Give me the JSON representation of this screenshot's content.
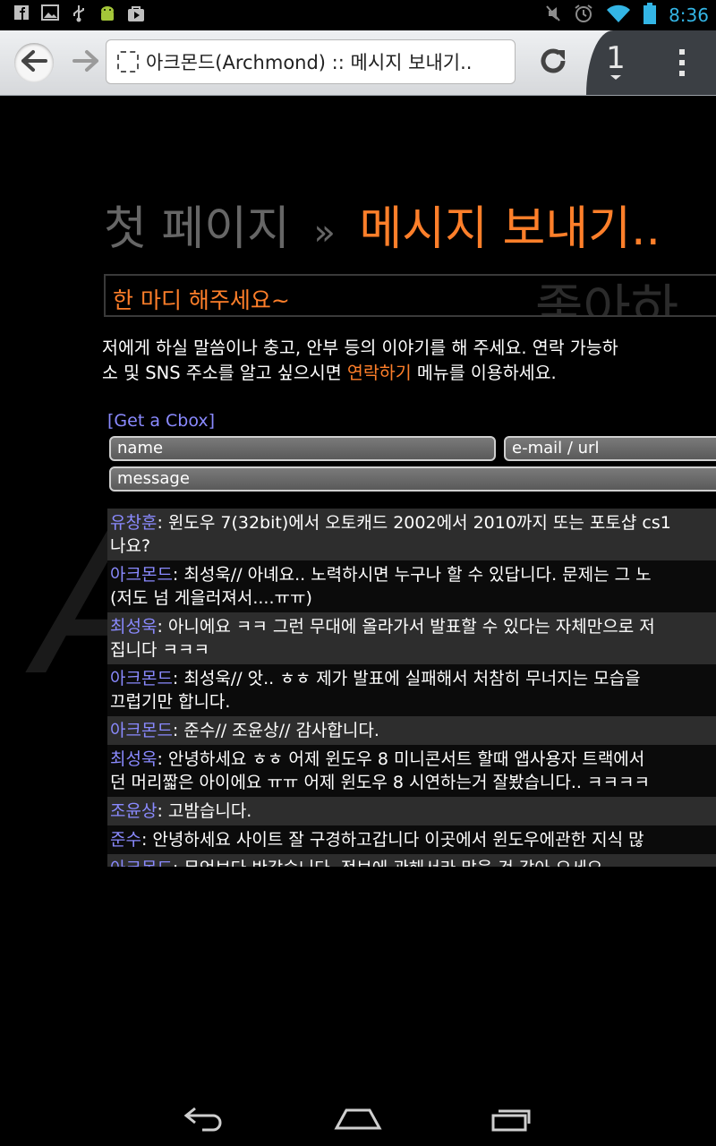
{
  "status_bar": {
    "left_icons": [
      "facebook-icon",
      "gallery-icon",
      "usb-icon",
      "android-icon",
      "play-store-icon"
    ],
    "right_icons": [
      "mute-icon",
      "alarm-icon",
      "wifi-icon",
      "battery-icon"
    ],
    "clock": "8:36"
  },
  "browser": {
    "tab_title": "아크몬드(Archmond) :: 메시지 보내기..",
    "tab_count": "1"
  },
  "page": {
    "heading_crumb": "첫 페이지",
    "heading_sep": "»",
    "heading_current": "메시지 보내기..",
    "subtitle": "한 마디 해주세요~",
    "subtitle_bg": "좋아하",
    "watermark": "A",
    "intro_line1": "저에게 하실 말씀이나 충고, 안부 등의 이야기를 해 주세요. 연락 가능하",
    "intro_line2_before": "소 및 SNS 주소를 알고 싶으시면 ",
    "intro_link": "연락하기",
    "intro_line2_after": " 메뉴를 이용하세요."
  },
  "cbox": {
    "get_cbox_label": "[Get a Cbox]",
    "name_placeholder": "name",
    "email_placeholder": "e-mail / url",
    "message_placeholder": "message",
    "messages": [
      {
        "author": "유창훈",
        "text": ": 윈도우 7(32bit)에서 오토캐드 2002에서 2010까지 또는 포토샵 cs1\n나요?"
      },
      {
        "author": "아크몬드",
        "text": ": 최성욱// 아녜요.. 노력하시면 누구나 할 수 있답니다. 문제는 그 노\n(저도 넘 게을러져서....ㅠㅠ)"
      },
      {
        "author": "최성욱",
        "text": ": 아니에요 ㅋㅋ 그런 무대에 올라가서 발표할 수 있다는 자체만으로 저\n집니다 ㅋㅋㅋ"
      },
      {
        "author": "아크몬드",
        "text": ": 최성욱// 앗.. ㅎㅎ 제가 발표에 실패해서 처참히 무너지는 모습을\n끄럽기만 합니다."
      },
      {
        "author": "아크몬드",
        "text": ": 준수// 조윤상// 감사합니다."
      },
      {
        "author": "최성욱",
        "text": ": 안녕하세요 ㅎㅎ 어제 윈도우 8 미니콘서트 할때 앱사용자 트랙에서\n던 머리짧은 아이에요 ㅠㅠ 어제 윈도우 8 시연하는거 잘봤습니다.. ㅋㅋㅋㅋ"
      },
      {
        "author": "조윤상",
        "text": ": 고밤습니다."
      },
      {
        "author": "준수",
        "text": ": 안녕하세요 사이트 잘 구경하고갑니다 이곳에서 윈도우에관한 지식 많"
      },
      {
        "author": "아크몬드",
        "text": ": 무엇보다 반갑습니다. 정보에 관해서라 많을 것 같아 오세요."
      }
    ]
  },
  "nav_bar": {
    "icons": [
      "back-icon",
      "home-icon",
      "recent-apps-icon"
    ]
  }
}
